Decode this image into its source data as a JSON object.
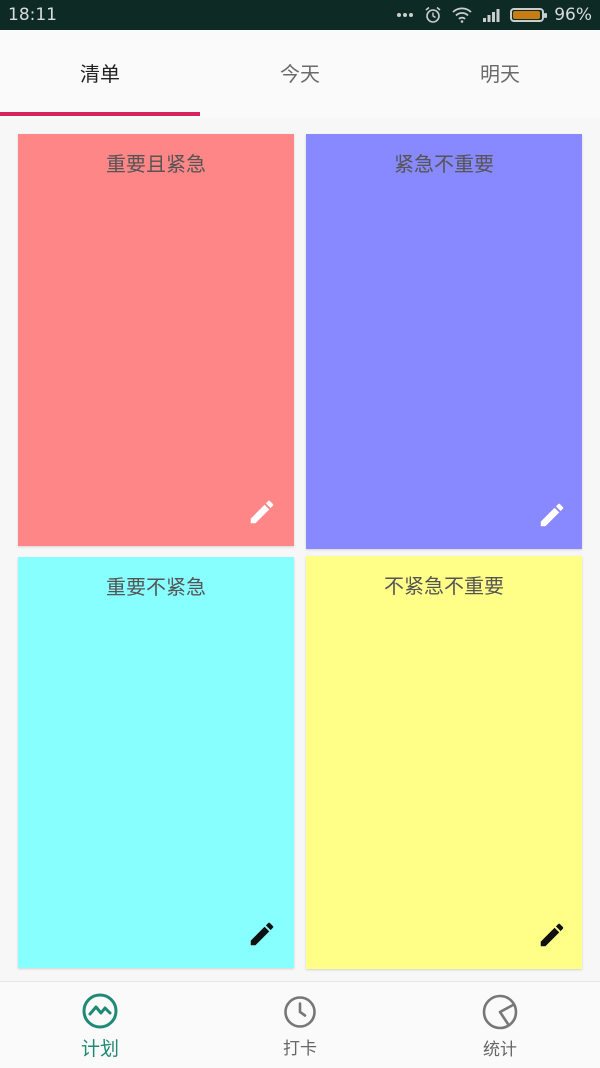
{
  "status_bar": {
    "time": "18:11",
    "battery_percent": "96%",
    "battery_level": 0.96
  },
  "tabs": [
    {
      "label": "清单",
      "active": true
    },
    {
      "label": "今天",
      "active": false
    },
    {
      "label": "明天",
      "active": false
    }
  ],
  "quadrants": [
    {
      "title": "重要且紧急",
      "color": "#ff8686",
      "edit_icon_color": "#ffffff"
    },
    {
      "title": "紧急不重要",
      "color": "#8888ff",
      "edit_icon_color": "#ffffff"
    },
    {
      "title": "重要不紧急",
      "color": "#88ffff",
      "edit_icon_color": "#111111"
    },
    {
      "title": "不紧急不重要",
      "color": "#ffff88",
      "edit_icon_color": "#111111"
    }
  ],
  "bottom_nav": [
    {
      "label": "计划",
      "icon": "trend-icon",
      "active": true
    },
    {
      "label": "打卡",
      "icon": "clock-icon",
      "active": false
    },
    {
      "label": "统计",
      "icon": "pie-chart-icon",
      "active": false
    }
  ],
  "colors": {
    "accent": "#d8245e",
    "nav_active": "#1e8a75",
    "status_bar": "#0e2a25"
  }
}
